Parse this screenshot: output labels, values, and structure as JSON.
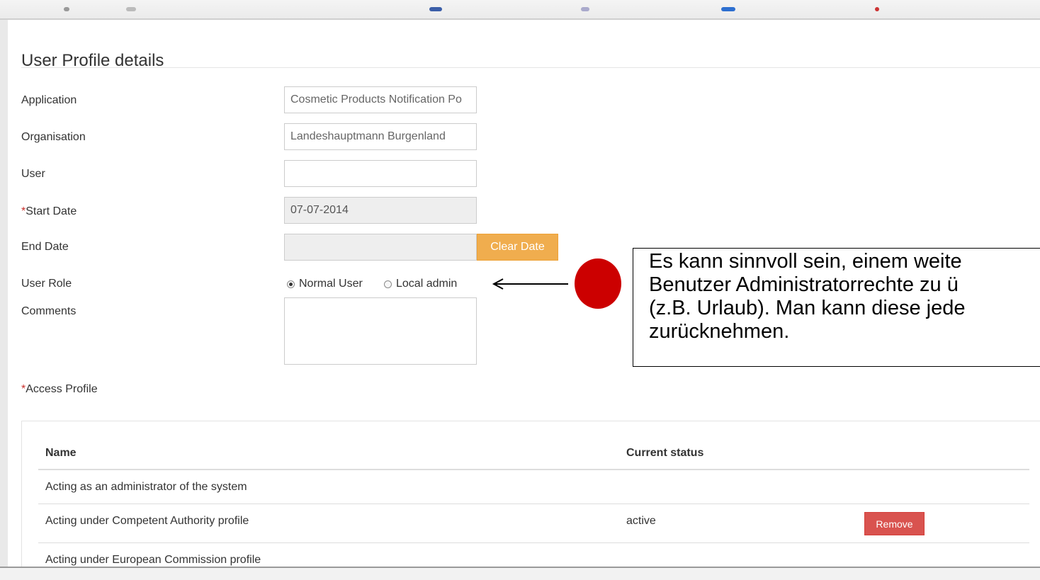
{
  "page": {
    "title": "User Profile details"
  },
  "form": {
    "application": {
      "label": "Application",
      "value": "Cosmetic Products Notification Po"
    },
    "organisation": {
      "label": "Organisation",
      "value": "Landeshauptmann Burgenland"
    },
    "user": {
      "label": "User",
      "value": ""
    },
    "start_date": {
      "required_mark": "*",
      "label": "Start Date",
      "value": "07-07-2014"
    },
    "end_date": {
      "label": "End Date",
      "value": "",
      "clear_label": "Clear Date"
    },
    "user_role": {
      "label": "User Role",
      "options": [
        {
          "label": "Normal User",
          "selected": true
        },
        {
          "label": "Local admin",
          "selected": false
        }
      ]
    },
    "comments": {
      "label": "Comments",
      "value": ""
    },
    "access_profile": {
      "required_mark": "*",
      "label": "Access Profile"
    }
  },
  "table": {
    "headers": {
      "name": "Name",
      "status": "Current status"
    },
    "rows": [
      {
        "name": "Acting as an administrator of the system",
        "status": "",
        "action": ""
      },
      {
        "name": "Acting under Competent Authority profile",
        "status": "active",
        "action": "Remove"
      },
      {
        "name": "Acting under European Commission profile",
        "status": "",
        "action": ""
      }
    ]
  },
  "annotation": {
    "text": "Es kann sinnvoll sein, einem weite\nBenutzer Administratorrechte zu ü\n(z.B. Urlaub). Man kann diese jede\nzurücknehmen.",
    "marker_color": "#cc0000"
  },
  "colors": {
    "clear_button": "#f0ad4e",
    "remove_button": "#d9534f",
    "required_asterisk": "#c9302c"
  }
}
